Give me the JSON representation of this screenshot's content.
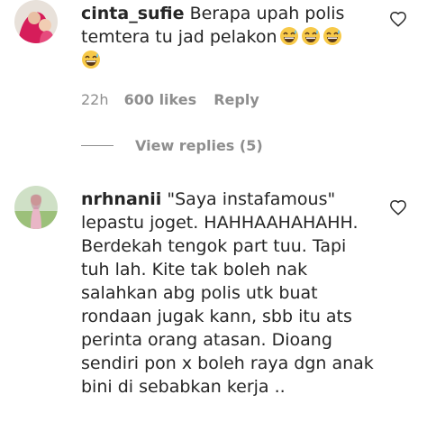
{
  "comments": [
    {
      "username": "cinta_sufie",
      "text_line1": "Berapa upah polis",
      "text_line2": "temtera tu jad pelakon",
      "emoji_name": "grinning-sweat-emoji",
      "time": "22h",
      "likes": "600 likes",
      "reply": "Reply",
      "view_replies": "View replies (5)"
    },
    {
      "username": "nrhnanii",
      "lines": [
        "\"Saya instafamous\"",
        "lepastu joget. HAHHAAHAHAHH.",
        "Berdekah tengok part tuu. Tapi",
        "tuh lah. Kite tak boleh nak",
        "salahkan abg polis utk buat",
        "rondaan jugak kann, sbb itu ats",
        "perinta orang atasan. Dioang",
        "sendiri pon x boleh raya dgn anak",
        "bini di sebabkan kerja .."
      ]
    }
  ],
  "icons": {
    "like": "heart-outline-icon"
  },
  "colors": {
    "text": "#262626",
    "secondary": "#8e8e8e",
    "emoji": "#f7c948"
  }
}
